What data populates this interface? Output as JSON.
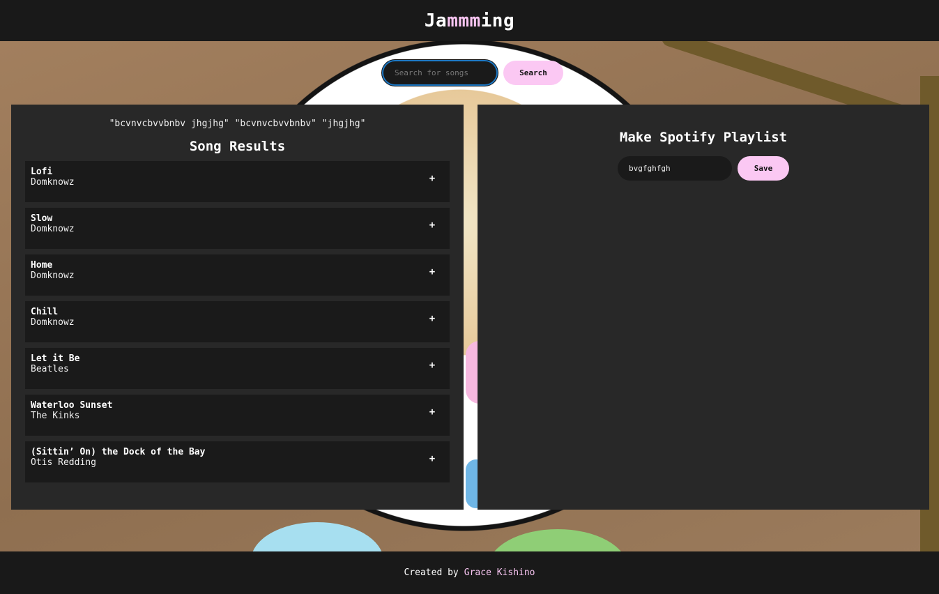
{
  "header": {
    "logo_prefix": "Ja",
    "logo_accent": "mmm",
    "logo_suffix": "ing"
  },
  "search": {
    "placeholder": "Search for songs",
    "value": "",
    "button_label": "Search"
  },
  "results": {
    "query_text": "\"bcvnvcbvvbnbv jhgjhg\" \"bcvnvcbvvbnbv\" \"jhgjhg\"",
    "title": "Song Results",
    "add_label": "+",
    "tracks": [
      {
        "name": "Lofi",
        "artist": "Domknowz"
      },
      {
        "name": "Slow",
        "artist": "Domknowz"
      },
      {
        "name": "Home",
        "artist": "Domknowz"
      },
      {
        "name": "Chill",
        "artist": "Domknowz"
      },
      {
        "name": "Let it Be",
        "artist": "Beatles"
      },
      {
        "name": "Waterloo Sunset",
        "artist": "The Kinks"
      },
      {
        "name": "(Sittin’ On) the Dock of the Bay",
        "artist": "Otis Redding"
      }
    ]
  },
  "playlist": {
    "title": "Make Spotify Playlist",
    "name_value": "bvgfghfgh",
    "save_label": "Save"
  },
  "footer": {
    "prefix": "Created by",
    "author": "Grace Kishino"
  },
  "colors": {
    "accent_pink": "#fbc8f3",
    "panel_bg": "#282828",
    "bar_bg": "#191919",
    "focus_blue": "#1c77c3"
  }
}
